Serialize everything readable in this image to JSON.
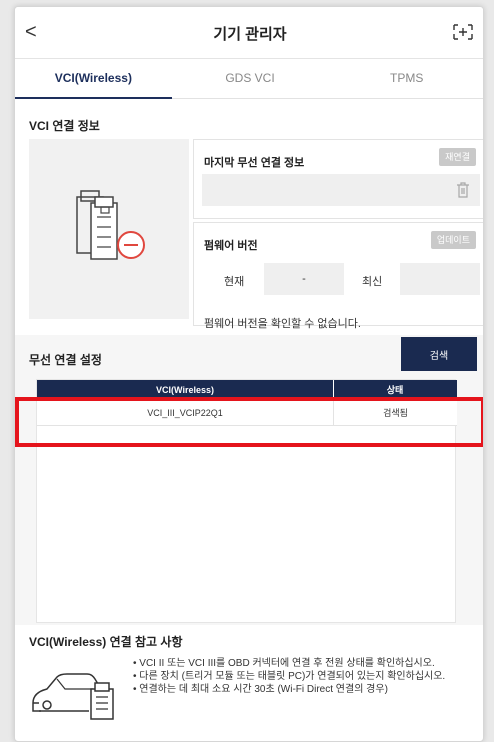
{
  "header": {
    "back_glyph": "<",
    "title": "기기 관리자",
    "expand_glyph": "[+]"
  },
  "tabs": [
    {
      "label": "VCI(Wireless)",
      "active": true
    },
    {
      "label": "GDS VCI",
      "active": false
    },
    {
      "label": "TPMS",
      "active": false
    }
  ],
  "vci_info": {
    "section_title": "VCI 연결 정보",
    "last_connection": {
      "title": "마지막 무선 연결 정보",
      "reconnect_label": "재연결",
      "value": ""
    },
    "firmware": {
      "title": "펌웨어 버전",
      "update_label": "업데이트",
      "current_label": "현재",
      "current_value": "-",
      "latest_label": "최신",
      "latest_value": "",
      "message": "펌웨어 버전을 확인할 수 없습니다."
    }
  },
  "wireless_settings": {
    "section_title": "무선 연결 설정",
    "search_label": "검색",
    "columns": [
      "VCI(Wireless)",
      "상태"
    ],
    "rows": [
      {
        "name": "VCI_III_VCIP22Q1",
        "status": "검색됨"
      }
    ]
  },
  "notes": {
    "title": "VCI(Wireless) 연결 참고 사항",
    "items": [
      "• VCI II 또는 VCI III를 OBD 커넥터에 연결 후 전원 상태를 확인하십시오.",
      "• 다른 장치 (트리거 모듈 또는 태블릿 PC)가 연결되어 있는지 확인하십시오.",
      "• 연결하는 데 최대 소요 시간 30초 (Wi-Fi Direct 연결의 경우)"
    ]
  },
  "colors": {
    "navy": "#1a2a50",
    "highlight_red": "#e5141c",
    "disabled_button": "#c9c9c9"
  }
}
